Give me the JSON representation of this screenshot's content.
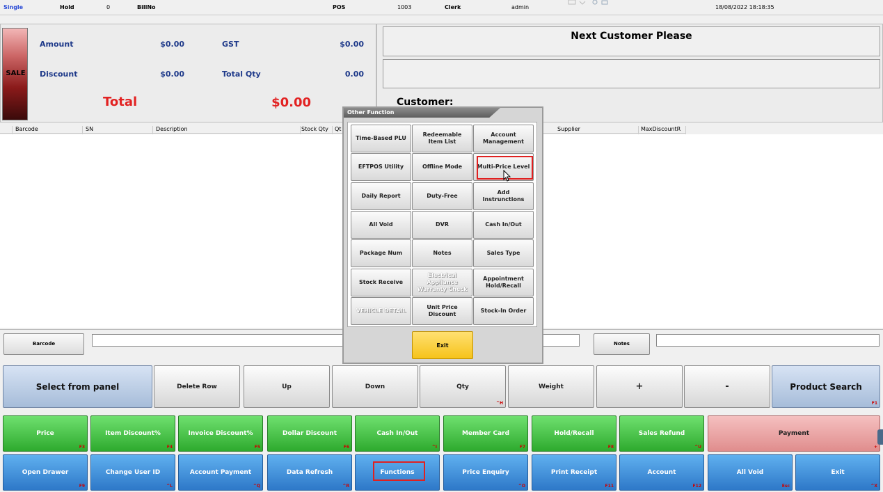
{
  "topbar": {
    "mode": "Single",
    "hold_label": "Hold",
    "hold_value": "0",
    "bill_label": "BillNo",
    "pos_label": "POS",
    "pos_value": "1003",
    "clerk_label": "Clerk",
    "clerk_value": "admin",
    "datetime": "18/08/2022 18:18:35"
  },
  "summary": {
    "sale_label": "SALE",
    "amount_label": "Amount",
    "amount_value": "$0.00",
    "gst_label": "GST",
    "gst_value": "$0.00",
    "discount_label": "Discount",
    "discount_value": "$0.00",
    "total_qty_label": "Total Qty",
    "total_qty_value": "0.00",
    "total_label": "Total",
    "total_value": "$0.00"
  },
  "display": {
    "message": "Next Customer Please",
    "customer_label": "Customer:"
  },
  "grid": {
    "columns": [
      "Barcode",
      "SN",
      "Description",
      "Stock Qty",
      "Qt",
      "Supplier",
      "MaxDiscountR"
    ]
  },
  "scan": {
    "barcode_button": "Barcode",
    "notes_button": "Notes"
  },
  "popup": {
    "title": "Other Function",
    "buttons": [
      {
        "label": "Time-Based PLU",
        "disabled": false
      },
      {
        "label": "Redeemable Item List",
        "disabled": false
      },
      {
        "label": "Account Management",
        "disabled": false
      },
      {
        "label": "EFTPOS Utility",
        "disabled": false
      },
      {
        "label": "Offline Mode",
        "disabled": false
      },
      {
        "label": "Multi-Price Level",
        "disabled": false
      },
      {
        "label": "Daily Report",
        "disabled": false
      },
      {
        "label": "Duty-Free",
        "disabled": false
      },
      {
        "label": "Add Instrunctions",
        "disabled": false
      },
      {
        "label": "All Void",
        "disabled": false
      },
      {
        "label": "DVR",
        "disabled": false
      },
      {
        "label": "Cash In/Out",
        "disabled": false
      },
      {
        "label": "Package Num",
        "disabled": false
      },
      {
        "label": "Notes",
        "disabled": false
      },
      {
        "label": "Sales Type",
        "disabled": false
      },
      {
        "label": "Stock Receive",
        "disabled": false
      },
      {
        "label": "Electrical Appliance Warranty Check",
        "disabled": true
      },
      {
        "label": "Appointment Hold/Recall",
        "disabled": false
      },
      {
        "label": "VEHICLE DETAIL",
        "disabled": true
      },
      {
        "label": "Unit Price Discount",
        "disabled": false
      },
      {
        "label": "Stock-In Order",
        "disabled": false
      }
    ],
    "exit_label": "Exit"
  },
  "row1": [
    {
      "label": "Select from panel",
      "key": "",
      "style": "bluel"
    },
    {
      "label": "Delete Row",
      "key": "",
      "style": "gray"
    },
    {
      "label": "Up",
      "key": "",
      "style": "gray"
    },
    {
      "label": "Down",
      "key": "",
      "style": "gray"
    },
    {
      "label": "Qty",
      "key": "^H",
      "style": "gray"
    },
    {
      "label": "Weight",
      "key": "",
      "style": "gray"
    },
    {
      "label": "+",
      "key": "",
      "style": "gray"
    },
    {
      "label": "-",
      "key": "",
      "style": "gray"
    },
    {
      "label": "Product Search",
      "key": "F1",
      "style": "bluel"
    }
  ],
  "row2": [
    {
      "label": "Price",
      "key": "F3",
      "style": "green"
    },
    {
      "label": "Item Discount%",
      "key": "F4",
      "style": "green"
    },
    {
      "label": "Invoice Discount%",
      "key": "F5",
      "style": "green"
    },
    {
      "label": "Dollar Discount",
      "key": "F6",
      "style": "green"
    },
    {
      "label": "Cash In/Out",
      "key": "^I",
      "style": "green"
    },
    {
      "label": "Member Card",
      "key": "F7",
      "style": "green"
    },
    {
      "label": "Hold/Recall",
      "key": "F8",
      "style": "green"
    },
    {
      "label": "Sales Refund",
      "key": "^U",
      "style": "green"
    },
    {
      "label": "Payment",
      "key": "+",
      "style": "pink"
    }
  ],
  "row3": [
    {
      "label": "Open Drawer",
      "key": "F9",
      "style": "blue"
    },
    {
      "label": "Change User ID",
      "key": "^L",
      "style": "blue"
    },
    {
      "label": "Account Payment",
      "key": "^Q",
      "style": "blue"
    },
    {
      "label": "Data Refresh",
      "key": "^R",
      "style": "blue"
    },
    {
      "label": "Functions",
      "key": "",
      "style": "blue"
    },
    {
      "label": "Price Enquiry",
      "key": "^O",
      "style": "blue"
    },
    {
      "label": "Print Receipt",
      "key": "F11",
      "style": "blue"
    },
    {
      "label": "Account",
      "key": "F12",
      "style": "blue"
    },
    {
      "label": "All Void",
      "key": "Esc",
      "style": "blue"
    },
    {
      "label": "Exit",
      "key": "^X",
      "style": "blue"
    }
  ]
}
